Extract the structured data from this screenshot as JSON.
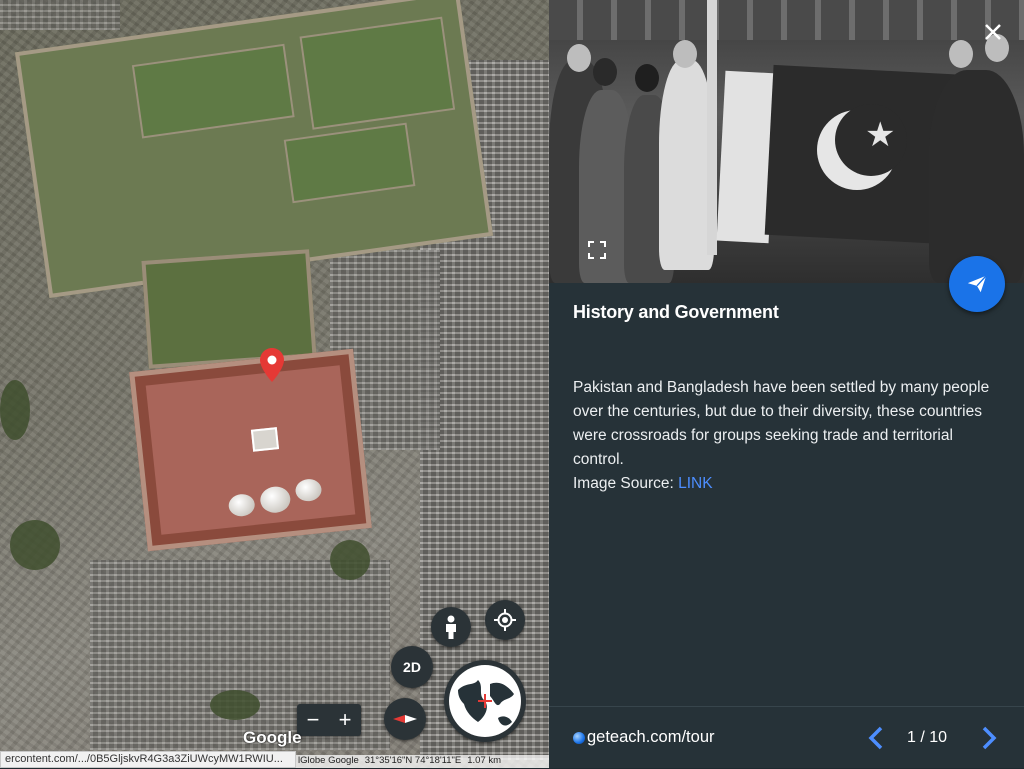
{
  "map": {
    "google_logo": "Google",
    "status_url": "ercontent.com/.../0B5GljskvR4G3a3ZiUWcyMW1RWIU...",
    "attribution": {
      "imagery": "lGlobe  Google",
      "coords": "31°35'16\"N 74°18'11\"E",
      "scale": "1.07 km"
    },
    "controls": {
      "zoom_out": "−",
      "zoom_in": "+",
      "view_2d": "2D"
    },
    "icons": [
      "pegman-icon",
      "my-location-icon",
      "compass-icon",
      "globe-icon",
      "location-pin-icon"
    ]
  },
  "panel": {
    "title": "History and Government",
    "body": "Pakistan and Bangladesh have been settled by many people over the centuries, but due to their diversity, these countries were crossroads for groups seeking trade and territorial control.",
    "source_label": "Image Source: ",
    "source_link": "LINK",
    "footer": {
      "brand": "geteach.com/tour",
      "page_current": "1",
      "page_total": "10",
      "page_text": "1 / 10"
    }
  },
  "colors": {
    "panel_bg": "#263238",
    "accent": "#1a73e8",
    "link": "#4d8eff",
    "pin": "#e53935"
  }
}
